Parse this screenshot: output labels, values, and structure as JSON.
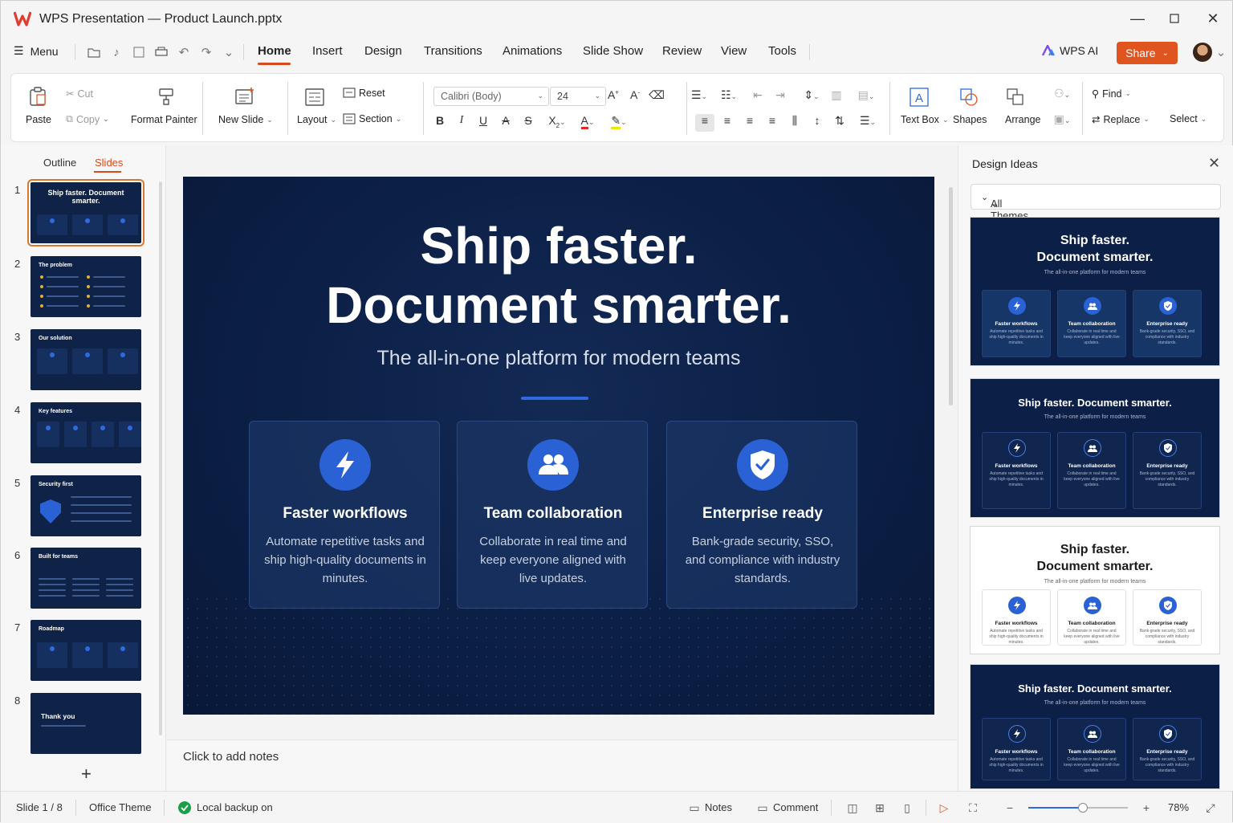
{
  "window": {
    "title": "WPS Presentation — Product Launch.pptx"
  },
  "menu": {
    "menu_label": "Menu",
    "tabs": [
      "Home",
      "Insert",
      "Design",
      "Transitions",
      "Animations",
      "Slide Show",
      "Review",
      "View",
      "Tools"
    ],
    "active_tab": "Home",
    "wps_ai": "WPS AI",
    "share": "Share"
  },
  "ribbon": {
    "paste": "Paste",
    "cut": "Cut",
    "copy": "Copy",
    "format_painter": "Format Painter",
    "new_slide": "New Slide",
    "layout": "Layout",
    "reset": "Reset",
    "section": "Section",
    "font_name": "Calibri (Body)",
    "font_size": "24",
    "text_box": "Text Box",
    "shapes": "Shapes",
    "arrange": "Arrange",
    "find": "Find",
    "replace": "Replace",
    "select": "Select",
    "font_color": "#d32f2f",
    "highlight_color": "#f5e400"
  },
  "panes": {
    "outline": "Outline",
    "slides": "Slides"
  },
  "thumbnails": [
    {
      "num": "1",
      "title": "Ship faster. Document smarter."
    },
    {
      "num": "2",
      "title": "The problem"
    },
    {
      "num": "3",
      "title": "Our solution"
    },
    {
      "num": "4",
      "title": "Key features"
    },
    {
      "num": "5",
      "title": "Security first"
    },
    {
      "num": "6",
      "title": "Built for teams"
    },
    {
      "num": "7",
      "title": "Roadmap"
    },
    {
      "num": "8",
      "title": "Thank you"
    }
  ],
  "slide": {
    "title_line1": "Ship faster.",
    "title_line2": "Document smarter.",
    "subtitle": "The all-in-one platform for modern teams",
    "cards": [
      {
        "icon": "lightning-icon",
        "title": "Faster workflows",
        "text": "Automate repetitive tasks and ship high-quality documents in minutes."
      },
      {
        "icon": "people-icon",
        "title": "Team collaboration",
        "text": "Collaborate in real time and keep everyone aligned with live updates."
      },
      {
        "icon": "shield-check-icon",
        "title": "Enterprise ready",
        "text": "Bank-grade security, SSO, and compliance with industry standards."
      }
    ]
  },
  "notes": {
    "placeholder": "Click to add notes"
  },
  "design_ideas": {
    "title": "Design Ideas",
    "filter": "All Themes",
    "ideas": [
      {
        "title_line1": "Ship faster.",
        "title_line2": "Document smarter.",
        "subtitle": "The all-in-one platform for modern teams",
        "theme": "dark"
      },
      {
        "title_line1": "Ship faster. Document smarter.",
        "title_line2": "",
        "subtitle": "The all-in-one platform for modern teams",
        "theme": "dark"
      },
      {
        "title_line1": "Ship faster.",
        "title_line2": "Document smarter.",
        "subtitle": "The all-in-one platform for modern teams",
        "theme": "light"
      },
      {
        "title_line1": "Ship faster. Document smarter.",
        "title_line2": "",
        "subtitle": "The all-in-one platform for modern teams",
        "theme": "dark"
      }
    ]
  },
  "status": {
    "slide_counter": "Slide 1 / 8",
    "theme": "Office Theme",
    "backup": "Local backup on",
    "notes": "Notes",
    "comment": "Comment",
    "zoom": "78%",
    "zoom_fraction": 0.55
  },
  "colors": {
    "accent": "#d84a1b",
    "slide_bg": "#0b1e44",
    "icon_blue": "#2a62d6"
  }
}
